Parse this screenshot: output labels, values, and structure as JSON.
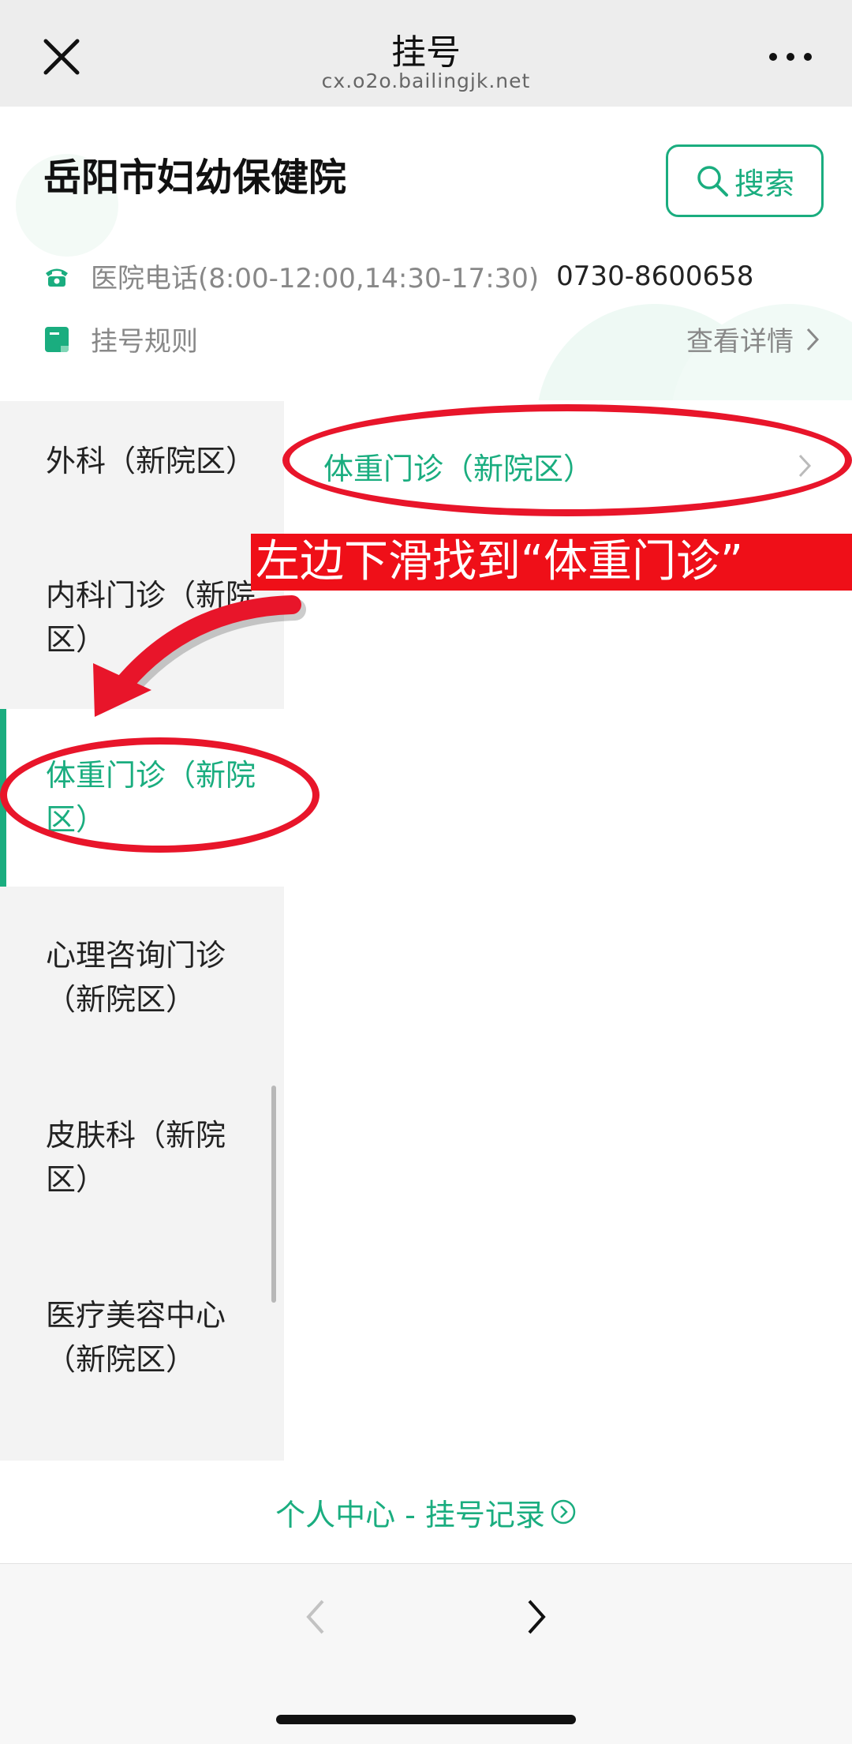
{
  "nav": {
    "title": "挂号",
    "url": "cx.o2o.bailingjk.net",
    "close_icon": "close-icon",
    "more_icon": "more-icon"
  },
  "header": {
    "hospital_name": "岳阳市妇幼保健院",
    "search_label": "搜索",
    "phone_label": "医院电话(8:00-12:00,14:30-17:30)",
    "phone_number": "0730-8600658",
    "rules_label": "挂号规则",
    "details_label": "查看详情"
  },
  "sidebar": {
    "items": [
      {
        "label": "外科（新院区）",
        "active": false
      },
      {
        "label": "内科门诊（新院区）",
        "active": false
      },
      {
        "label": "体重门诊（新院区）",
        "active": true
      },
      {
        "label": "心理咨询门诊（新院区）",
        "active": false
      },
      {
        "label": "皮肤科（新院区）",
        "active": false
      },
      {
        "label": "医疗美容中心（新院区）",
        "active": false
      }
    ]
  },
  "department": {
    "label": "体重门诊（新院区）"
  },
  "annotation": {
    "banner_text": "左边下滑找到“体重门诊”"
  },
  "footer": {
    "link_label": "个人中心 - 挂号记录"
  },
  "colors": {
    "accent": "#1aad7f",
    "annotation_red": "#e8152a"
  }
}
